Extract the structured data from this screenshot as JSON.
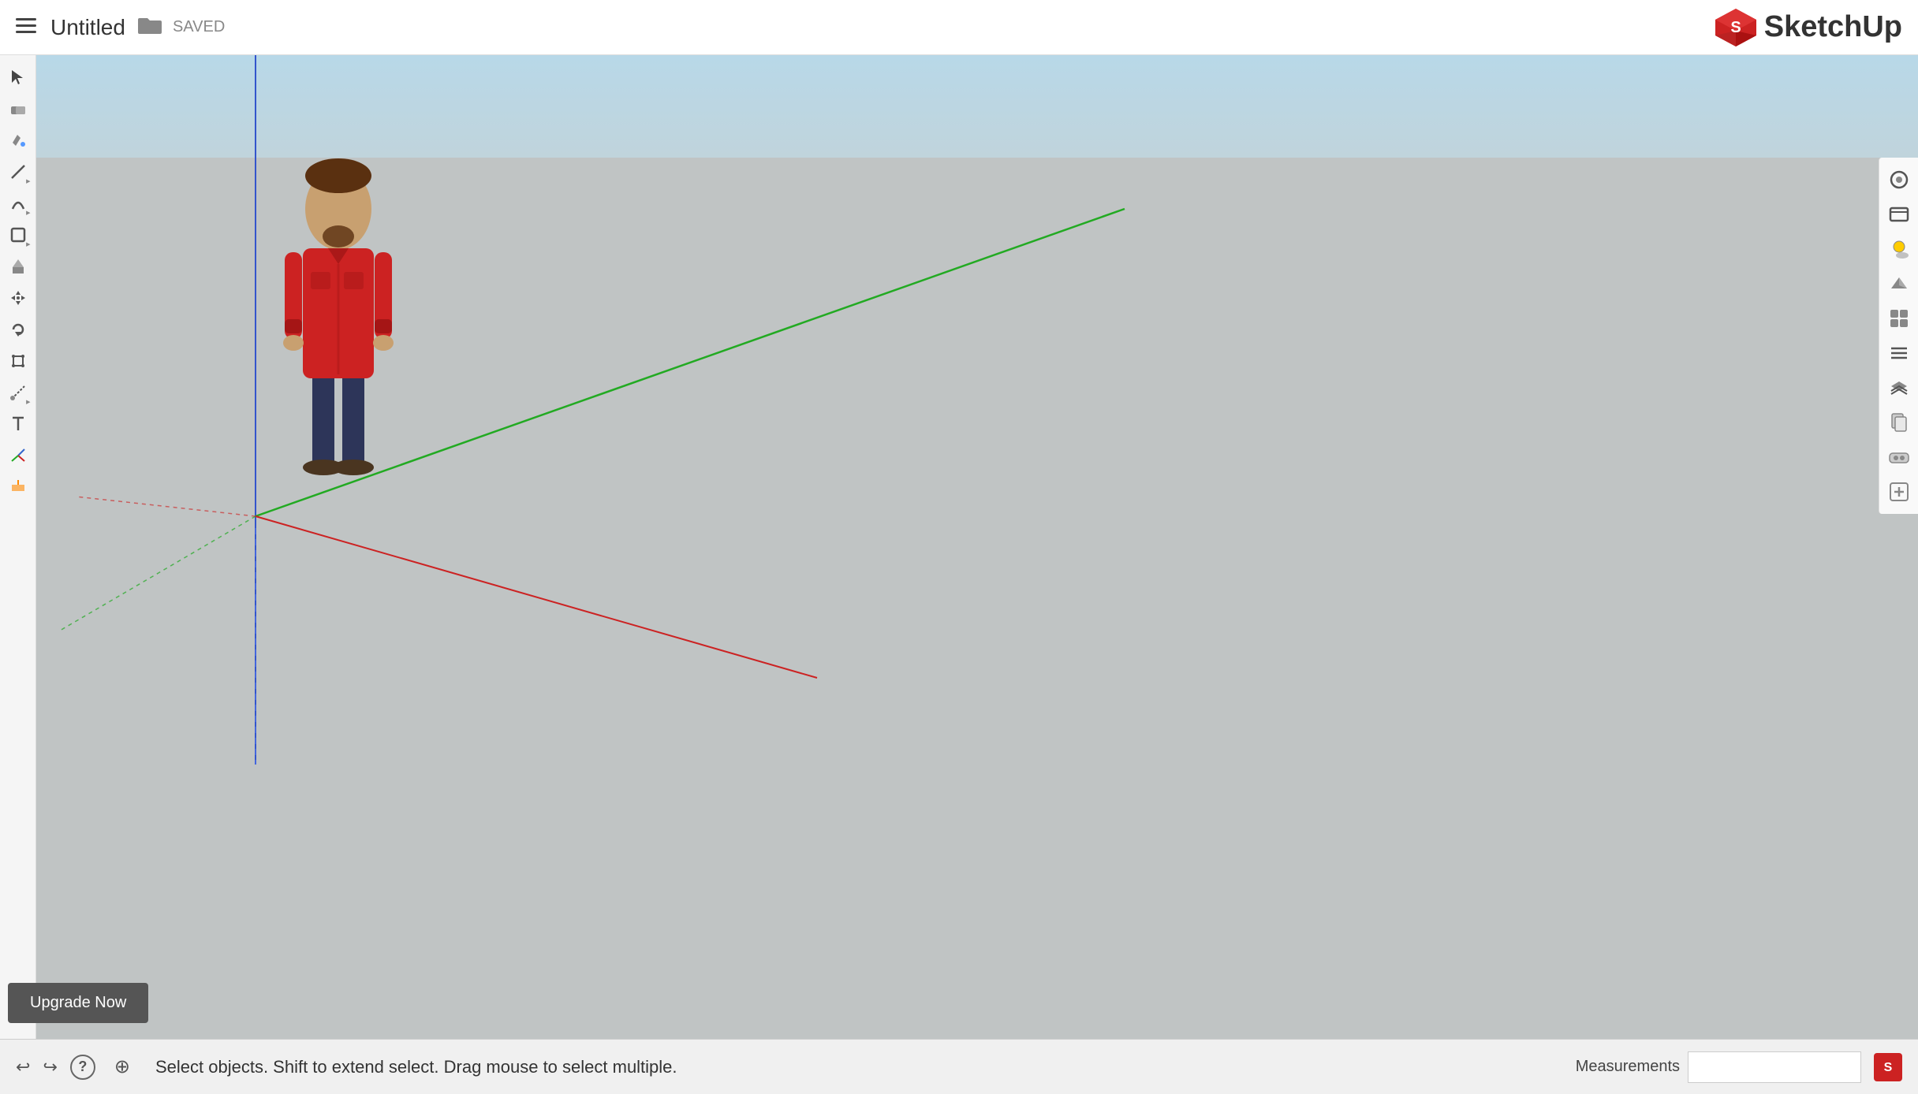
{
  "header": {
    "menu_label": "☰",
    "title": "Untitled",
    "folder_icon": "🗀",
    "saved_label": "SAVED",
    "logo_text": "SketchUp"
  },
  "toolbar_left": {
    "tools": [
      {
        "name": "select",
        "icon": "cursor",
        "has_arrow": false
      },
      {
        "name": "eraser",
        "icon": "eraser",
        "has_arrow": false
      },
      {
        "name": "paint",
        "icon": "paint",
        "has_arrow": false
      },
      {
        "name": "line",
        "icon": "line",
        "has_arrow": true
      },
      {
        "name": "arc",
        "icon": "arc",
        "has_arrow": true
      },
      {
        "name": "shape",
        "icon": "shape",
        "has_arrow": true
      },
      {
        "name": "push-pull",
        "icon": "pushpull",
        "has_arrow": false
      },
      {
        "name": "move",
        "icon": "move",
        "has_arrow": false
      },
      {
        "name": "rotate",
        "icon": "rotate",
        "has_arrow": false
      },
      {
        "name": "scale",
        "icon": "scale",
        "has_arrow": false
      },
      {
        "name": "tape",
        "icon": "tape",
        "has_arrow": true
      },
      {
        "name": "text",
        "icon": "text",
        "has_arrow": false
      },
      {
        "name": "axes",
        "icon": "axes",
        "has_arrow": false
      },
      {
        "name": "section",
        "icon": "section",
        "has_arrow": false
      }
    ]
  },
  "toolbar_right": {
    "tools": [
      {
        "name": "styles",
        "icon": "styles"
      },
      {
        "name": "scenes",
        "icon": "scenes"
      },
      {
        "name": "shadows",
        "icon": "shadows"
      },
      {
        "name": "3dwarehouse",
        "icon": "3dwarehouse"
      },
      {
        "name": "components",
        "icon": "components"
      },
      {
        "name": "outliner",
        "icon": "outliner"
      },
      {
        "name": "layers",
        "icon": "layers"
      },
      {
        "name": "pages",
        "icon": "pages"
      },
      {
        "name": "vr",
        "icon": "vr"
      },
      {
        "name": "extension",
        "icon": "extension"
      }
    ]
  },
  "canvas": {
    "status_text": "Select objects. Shift to extend select. Drag mouse to select multiple.",
    "measurements_label": "Measurements",
    "measurements_value": ""
  },
  "upgrade_button": {
    "label": "Upgrade Now"
  },
  "bottom_icons": [
    {
      "name": "undo",
      "icon": "↩"
    },
    {
      "name": "redo",
      "icon": "↪"
    },
    {
      "name": "help",
      "icon": "?"
    },
    {
      "name": "location",
      "icon": "⊕"
    }
  ]
}
